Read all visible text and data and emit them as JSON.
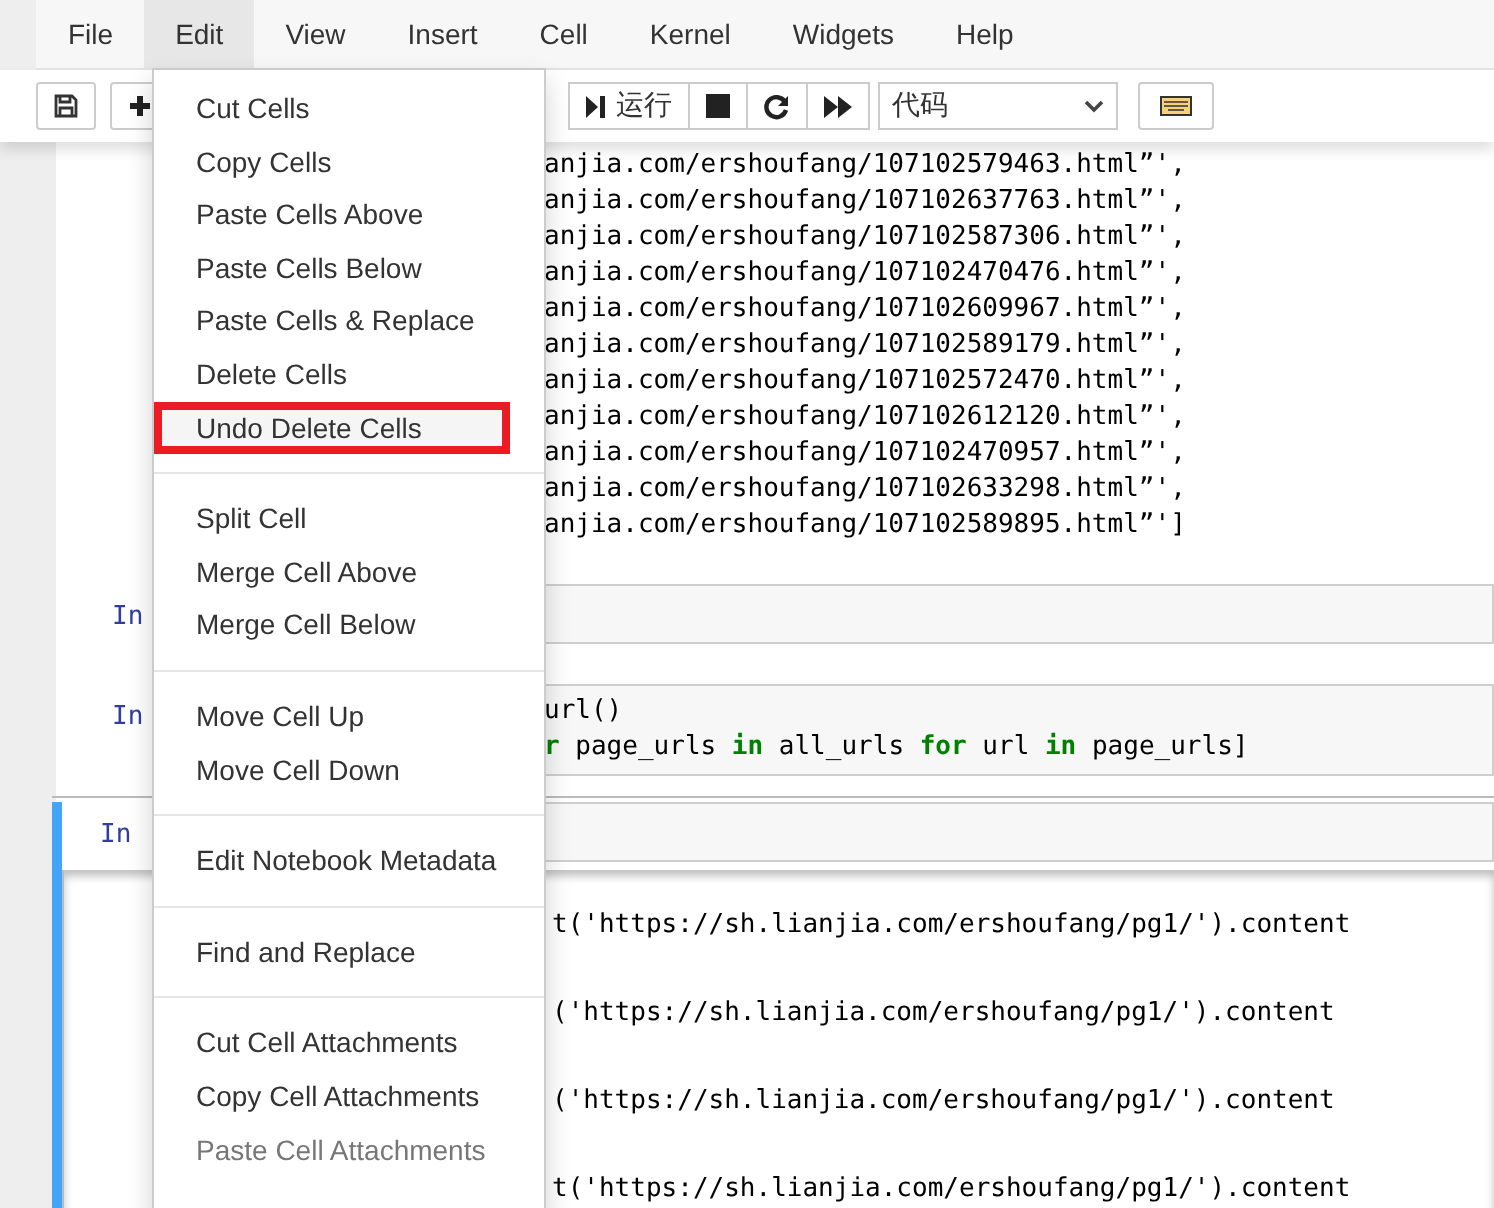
{
  "menubar": [
    {
      "label": "File",
      "selected": false
    },
    {
      "label": "Edit",
      "selected": true
    },
    {
      "label": "View",
      "selected": false
    },
    {
      "label": "Insert",
      "selected": false
    },
    {
      "label": "Cell",
      "selected": false
    },
    {
      "label": "Kernel",
      "selected": false
    },
    {
      "label": "Widgets",
      "selected": false
    },
    {
      "label": "Help",
      "selected": false
    }
  ],
  "toolbar": {
    "run_label": "运行",
    "cell_type": "代码"
  },
  "cells": [
    {
      "kind": "output",
      "lines": [
        "anjia.com/ershoufang/107102579463.html”',",
        "anjia.com/ershoufang/107102637763.html”',",
        "anjia.com/ershoufang/107102587306.html”',",
        "anjia.com/ershoufang/107102470476.html”',",
        "anjia.com/ershoufang/107102609967.html”',",
        "anjia.com/ershoufang/107102589179.html”',",
        "anjia.com/ershoufang/107102572470.html”',",
        "anjia.com/ershoufang/107102612120.html”',",
        "anjia.com/ershoufang/107102470957.html”',",
        "anjia.com/ershoufang/107102633298.html”',",
        "anjia.com/ershoufang/107102589895.html”']"
      ]
    },
    {
      "kind": "code",
      "selected": false,
      "prompt": "In"
    },
    {
      "kind": "code",
      "selected": false,
      "prompt": "In",
      "lines": [
        [
          {
            "text": "url()",
            "kind": "plain"
          }
        ],
        [
          {
            "text": "r",
            "kind": "keyword"
          },
          {
            "text": " page_urls ",
            "kind": "plain"
          },
          {
            "text": "in",
            "kind": "keyword"
          },
          {
            "text": " all_urls ",
            "kind": "plain"
          },
          {
            "text": "for",
            "kind": "keyword"
          },
          {
            "text": " url ",
            "kind": "plain"
          },
          {
            "text": "in",
            "kind": "keyword"
          },
          {
            "text": " page_urls]",
            "kind": "plain"
          }
        ]
      ]
    },
    {
      "kind": "code",
      "selected": true,
      "prompt": "In",
      "output": [
        "t('https://sh.lianjia.com/ershoufang/pg1/').content",
        "('https://sh.lianjia.com/ershoufang/pg1/').content",
        "('https://sh.lianjia.com/ershoufang/pg1/').content",
        "t('https://sh.lianjia.com/ershoufang/pg1/').content"
      ]
    }
  ],
  "edit_menu": [
    [
      {
        "label": "Cut Cells",
        "disabled": false,
        "highlighted": false
      },
      {
        "label": "Copy Cells",
        "disabled": false,
        "highlighted": false
      },
      {
        "label": "Paste Cells Above",
        "disabled": false,
        "highlighted": false
      },
      {
        "label": "Paste Cells Below",
        "disabled": false,
        "highlighted": false
      },
      {
        "label": "Paste Cells & Replace",
        "disabled": false,
        "highlighted": false
      },
      {
        "label": "Delete Cells",
        "disabled": false,
        "highlighted": false
      },
      {
        "label": "Undo Delete Cells",
        "disabled": false,
        "highlighted": true
      }
    ],
    [
      {
        "label": "Split Cell",
        "disabled": false,
        "highlighted": false
      },
      {
        "label": "Merge Cell Above",
        "disabled": false,
        "highlighted": false
      },
      {
        "label": "Merge Cell Below",
        "disabled": false,
        "highlighted": false
      }
    ],
    [
      {
        "label": "Move Cell Up",
        "disabled": false,
        "highlighted": false
      },
      {
        "label": "Move Cell Down",
        "disabled": false,
        "highlighted": false
      }
    ],
    [
      {
        "label": "Edit Notebook Metadata",
        "disabled": false,
        "highlighted": false
      }
    ],
    [
      {
        "label": "Find and Replace",
        "disabled": false,
        "highlighted": false
      }
    ],
    [
      {
        "label": "Cut Cell Attachments",
        "disabled": false,
        "highlighted": false
      },
      {
        "label": "Copy Cell Attachments",
        "disabled": false,
        "highlighted": false
      },
      {
        "label": "Paste Cell Attachments",
        "disabled": true,
        "highlighted": false
      }
    ]
  ]
}
